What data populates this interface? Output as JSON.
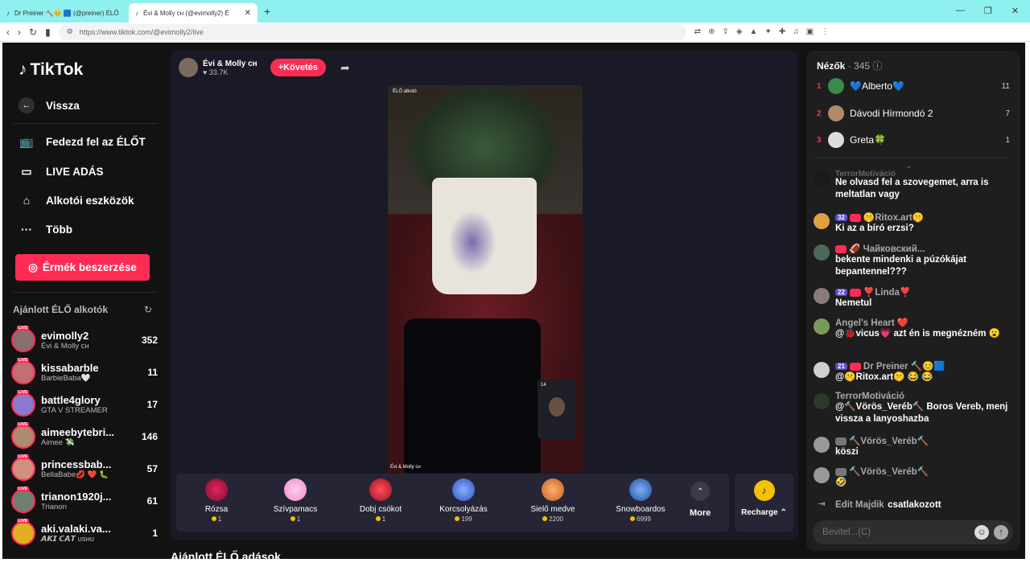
{
  "browser": {
    "tabs": [
      {
        "title": "Dr Preiner 🔨😊 🟦 (@preiner) ÉLŐ",
        "active": false
      },
      {
        "title": "Évi & Molly ᴄʜ (@evimolly2) É",
        "active": true
      }
    ],
    "url": "https://www.tiktok.com/@evimolly2/live"
  },
  "sidebar": {
    "logo": "TikTok",
    "back": "Vissza",
    "nav": [
      "Fedezd fel az ÉLŐT",
      "LIVE ADÁS",
      "Alkotói eszközök",
      "Több"
    ],
    "coins_button": "Érmék beszerzése",
    "recommended_title": "Ajánlott ÉLŐ alkotók",
    "creators": [
      {
        "name": "evimolly2",
        "sub": "Évi & Molly ᴄʜ",
        "count": "352"
      },
      {
        "name": "kissabarble",
        "sub": "BarbieBaba🤍",
        "count": "11"
      },
      {
        "name": "battle4glory",
        "sub": "GTA V STREAMER",
        "count": "17"
      },
      {
        "name": "aimeebytebri...",
        "sub": "Aimee 💸",
        "count": "146"
      },
      {
        "name": "princessbab...",
        "sub": "BellaBabe💋 ❤️ 🐛",
        "count": "57"
      },
      {
        "name": "trianon1920j...",
        "sub": "Trianon",
        "count": "61"
      },
      {
        "name": "aki.valaki.va...",
        "sub": "𝘼𝙆𝙄 𝘾𝘼𝙏 ᴜsʜᴜ",
        "count": "1"
      }
    ],
    "live_label": "LIVE"
  },
  "stream": {
    "host_name": "Évi & Molly ᴄʜ",
    "host_likes": "33.7K",
    "follow_label": "Követés",
    "video_label": "ÉLŐ alkotó",
    "video_host": "Évi & Molly ᴄʜ",
    "pip_count": "14"
  },
  "gifts": [
    {
      "name": "Rózsa",
      "price": "1",
      "color": "#e0245e"
    },
    {
      "name": "Szívpamacs",
      "price": "1",
      "color": "#f7a8d8"
    },
    {
      "name": "Dobj csókot",
      "price": "1",
      "color": "#d02030"
    },
    {
      "name": "Korcsolyázás",
      "price": "199",
      "color": "#4a6ad0"
    },
    {
      "name": "Sielő medve",
      "price": "2200",
      "color": "#d88040"
    },
    {
      "name": "Snowboardos",
      "price": "6999",
      "color": "#3a70c0"
    }
  ],
  "gifts_more": "More",
  "recharge": "Recharge",
  "bottom_title": "Ajánlott ÉLŐ adások",
  "chat": {
    "viewers_title": "Nézők",
    "viewers_count": "· 345",
    "top_viewers": [
      {
        "rank": "1",
        "name": "💙Alberto💙",
        "score": "11"
      },
      {
        "rank": "2",
        "name": "Dávodi Hírmondó 2",
        "score": "7"
      },
      {
        "rank": "3",
        "name": "Greta🍀",
        "score": "1"
      }
    ],
    "messages": [
      {
        "user": "TerrorMotiváció",
        "badge": "",
        "text": "Ne olvasd fel a szovegemet, arra is meltatlan vagy"
      },
      {
        "user": "🤫Ritox.art🤫",
        "badge": "32",
        "text": "Ki az a bíró erzsi?"
      },
      {
        "user": "🏈 Чайковский...",
        "badge": "",
        "text": "bekente mindenki a púzókájat bepantennel???"
      },
      {
        "user": "❣️Linda❣️",
        "badge": "22",
        "text": "Nemetul"
      },
      {
        "user": "Angel's Heart ❤️",
        "badge": "",
        "text": "@🐞vicus💗 azt én is megnézném 😮"
      },
      {
        "user": "Dr Preiner 🔨😊🟦",
        "badge": "21",
        "text": "@🤫Ritox.art🤫 😂 😂"
      },
      {
        "user": "TerrorMotiváció",
        "badge": "",
        "text": "@🔨Vörös_Veréb🔨 Boros Vereb, menj vissza a lanyoshazba"
      },
      {
        "user": "🔨Vörös_Veréb🔨",
        "badge": "",
        "text": "köszi"
      },
      {
        "user": "🔨Vörös_Veréb🔨",
        "badge": "",
        "text": "🤣"
      }
    ],
    "join_user": "Edit Majdik",
    "join_text": "csatlakozott",
    "input_placeholder": "Bevitel...(C)"
  }
}
